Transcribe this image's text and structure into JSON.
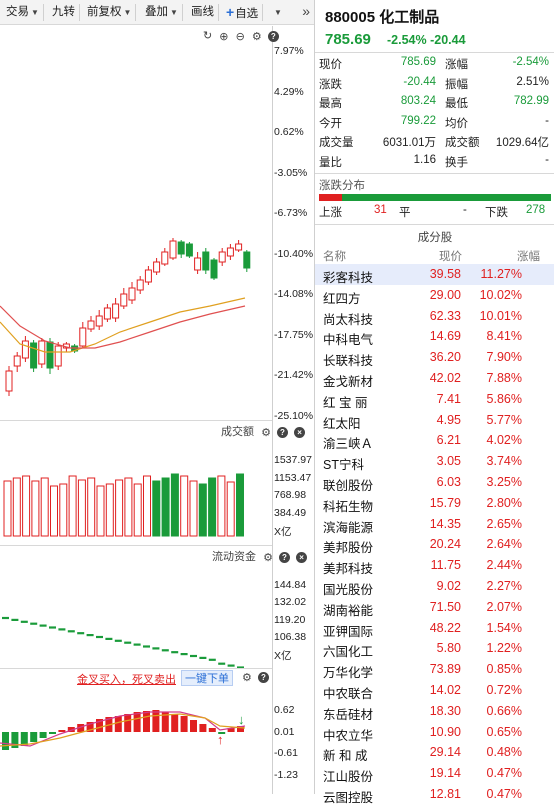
{
  "toolbar": {
    "trade": "交易",
    "nine_turn": "九转",
    "adjust": "前复权",
    "overlay": "叠加",
    "draw": "画线",
    "watchlist": "自选"
  },
  "kline": {
    "y_labels": [
      "7.97%",
      "4.29%",
      "0.62%",
      "-3.05%",
      "-6.73%",
      "-10.40%",
      "-14.08%",
      "-17.75%",
      "-21.42%",
      "-25.10%"
    ]
  },
  "volume": {
    "title": "成交额",
    "y_labels": [
      "1537.97",
      "1153.47",
      "768.98",
      "384.49",
      "X亿"
    ]
  },
  "flow": {
    "title": "流动资金",
    "y_labels": [
      "144.84",
      "132.02",
      "119.20",
      "106.38",
      "X亿"
    ]
  },
  "macd": {
    "strategy": "金叉买入，死叉卖出",
    "one_click_order": "一键下单",
    "y_labels": [
      "0.62",
      "0.01",
      "-0.61",
      "-1.23"
    ]
  },
  "quote": {
    "code": "880005",
    "name": "化工制品",
    "price": "785.69",
    "change": "-2.54% -20.44",
    "rows": [
      {
        "l1": "现价",
        "v1": "785.69",
        "c1": "green",
        "l2": "涨幅",
        "v2": "-2.54%",
        "c2": "green"
      },
      {
        "l1": "涨跌",
        "v1": "-20.44",
        "c1": "green",
        "l2": "振幅",
        "v2": "2.51%",
        "c2": "black"
      },
      {
        "l1": "最高",
        "v1": "803.24",
        "c1": "green",
        "l2": "最低",
        "v2": "782.99",
        "c2": "green"
      },
      {
        "l1": "今开",
        "v1": "799.22",
        "c1": "green",
        "l2": "均价",
        "v2": "-",
        "c2": "black"
      },
      {
        "l1": "成交量",
        "v1": "6031.01万",
        "c1": "black",
        "l2": "成交额",
        "v2": "1029.64亿",
        "c2": "black"
      },
      {
        "l1": "量比",
        "v1": "1.16",
        "c1": "black",
        "l2": "换手",
        "v2": "-",
        "c2": "black"
      }
    ]
  },
  "distribution": {
    "title": "涨跌分布",
    "up_label": "上涨",
    "up_count": "31",
    "flat_label": "平",
    "flat_count": "-",
    "down_label": "下跌",
    "down_count": "278"
  },
  "constituents": {
    "title": "成分股",
    "headers": [
      "名称",
      "现价",
      "涨幅"
    ],
    "rows": [
      {
        "name": "彩客科技",
        "price": "39.58",
        "pct": "11.27%"
      },
      {
        "name": "红四方",
        "price": "29.00",
        "pct": "10.02%"
      },
      {
        "name": "尚太科技",
        "price": "62.33",
        "pct": "10.01%"
      },
      {
        "name": "中科电气",
        "price": "14.69",
        "pct": "8.41%"
      },
      {
        "name": "长联科技",
        "price": "36.20",
        "pct": "7.90%"
      },
      {
        "name": "金戈新材",
        "price": "42.02",
        "pct": "7.88%"
      },
      {
        "name": "红 宝 丽",
        "price": "7.41",
        "pct": "5.86%"
      },
      {
        "name": "红太阳",
        "price": "4.95",
        "pct": "5.77%"
      },
      {
        "name": "渝三峡Ａ",
        "price": "6.21",
        "pct": "4.02%"
      },
      {
        "name": "ST宁科",
        "price": "3.05",
        "pct": "3.74%"
      },
      {
        "name": "联创股份",
        "price": "6.03",
        "pct": "3.25%"
      },
      {
        "name": "科拓生物",
        "price": "15.79",
        "pct": "2.80%"
      },
      {
        "name": "滨海能源",
        "price": "14.35",
        "pct": "2.65%"
      },
      {
        "name": "美邦股份",
        "price": "20.24",
        "pct": "2.64%"
      },
      {
        "name": "美邦科技",
        "price": "11.75",
        "pct": "2.44%"
      },
      {
        "name": "国光股份",
        "price": "9.02",
        "pct": "2.27%"
      },
      {
        "name": "湖南裕能",
        "price": "71.50",
        "pct": "2.07%"
      },
      {
        "name": "亚钾国际",
        "price": "48.22",
        "pct": "1.54%"
      },
      {
        "name": "六国化工",
        "price": "5.80",
        "pct": "1.22%"
      },
      {
        "name": "万华化学",
        "price": "73.89",
        "pct": "0.85%"
      },
      {
        "name": "中农联合",
        "price": "14.02",
        "pct": "0.72%"
      },
      {
        "name": "东岳硅材",
        "price": "18.30",
        "pct": "0.66%"
      },
      {
        "name": "中农立华",
        "price": "10.90",
        "pct": "0.65%"
      },
      {
        "name": "新 和 成",
        "price": "29.14",
        "pct": "0.48%"
      },
      {
        "name": "江山股份",
        "price": "19.14",
        "pct": "0.47%"
      },
      {
        "name": "云图控股",
        "price": "12.81",
        "pct": "0.47%"
      }
    ]
  },
  "colors": {
    "up": "#e02020",
    "down": "#1a9b3a",
    "accent": "#2b6fd6"
  }
}
